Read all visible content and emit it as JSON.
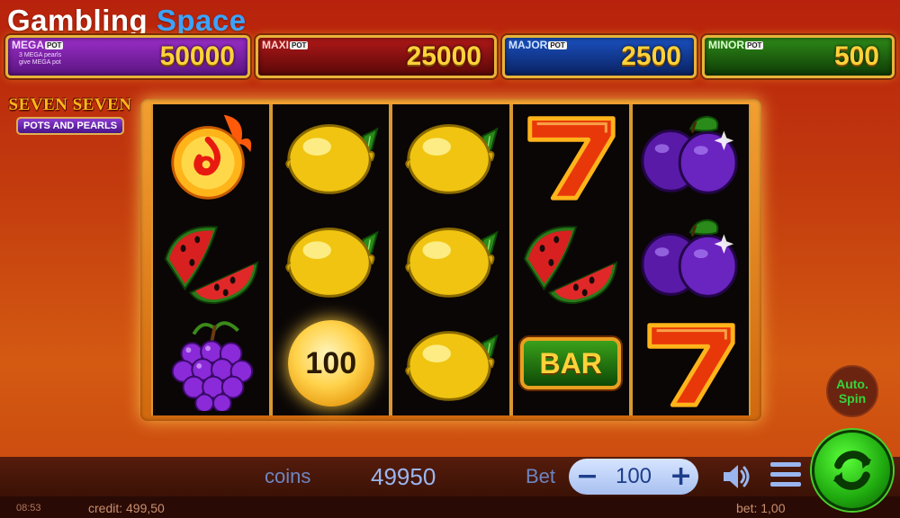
{
  "watermark": {
    "part1": "Gambling",
    "part2": "Space"
  },
  "jackpots": [
    {
      "name": "MEGA",
      "tag": "POT",
      "value": "50000",
      "note1": "3 MEGA pearls",
      "note2": "give MEGA pot"
    },
    {
      "name": "MAXI",
      "tag": "POT",
      "value": "25000"
    },
    {
      "name": "MAJOR",
      "tag": "POT",
      "value": "2500"
    },
    {
      "name": "MINOR",
      "tag": "POT",
      "value": "500"
    }
  ],
  "logo": {
    "title": "SEVEN SEVEN",
    "subtitle": "POTS AND PEARLS"
  },
  "reels": [
    [
      "fireball",
      "watermelon",
      "grapes"
    ],
    [
      "lemon",
      "lemon",
      "coin"
    ],
    [
      "lemon",
      "lemon",
      "lemon"
    ],
    [
      "seven",
      "watermelon",
      "bar"
    ],
    [
      "plum",
      "plum",
      "seven"
    ]
  ],
  "coin_value": "100",
  "bar_label": "BAR",
  "controls": {
    "coins_label": "coins",
    "coins_value": "49950",
    "bet_label": "Bet",
    "bet_value": "100",
    "minus": "−",
    "plus": "+",
    "auto_line1": "Auto.",
    "auto_line2": "Spin"
  },
  "status": {
    "time": "08:53",
    "credit": "credit: 499,50",
    "bet": "bet: 1,00"
  },
  "colors": {
    "accent_gold": "#ffd23a",
    "spin_green": "#1ea80e",
    "text_blue": "#9ab6f0"
  }
}
